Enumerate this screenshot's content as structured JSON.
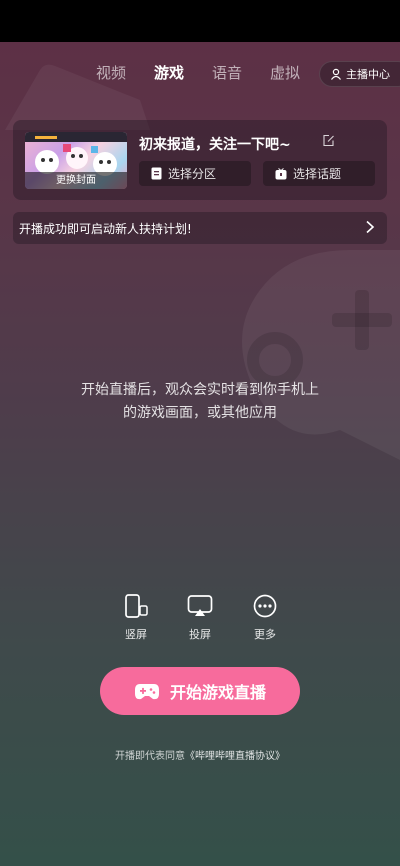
{
  "tabs": [
    {
      "label": "视频",
      "active": false
    },
    {
      "label": "游戏",
      "active": true
    },
    {
      "label": "语音",
      "active": false
    },
    {
      "label": "虚拟",
      "active": false
    }
  ],
  "host_center": {
    "label": "主播中心",
    "icon": "user-icon"
  },
  "card": {
    "cover_label": "更换封面",
    "title": "初来报道，关注一下吧~",
    "select_zone": "选择分区",
    "select_topic": "选择话题"
  },
  "banner": {
    "text": "开播成功即可启动新人扶持计划!"
  },
  "center_text": {
    "line1": "开始直播后，观众会实时看到你手机上",
    "line2": "的游戏画面，或其他应用"
  },
  "actions": [
    {
      "label": "竖屏",
      "icon": "phone-portrait-icon"
    },
    {
      "label": "投屏",
      "icon": "screen-cast-icon"
    },
    {
      "label": "更多",
      "icon": "more-icon"
    }
  ],
  "start_button": {
    "label": "开始游戏直播",
    "icon": "gamepad-icon",
    "color": "#f76b9c"
  },
  "agreement": {
    "prefix": "开播即代表同意",
    "link": "《哔哩哔哩直播协议》"
  }
}
